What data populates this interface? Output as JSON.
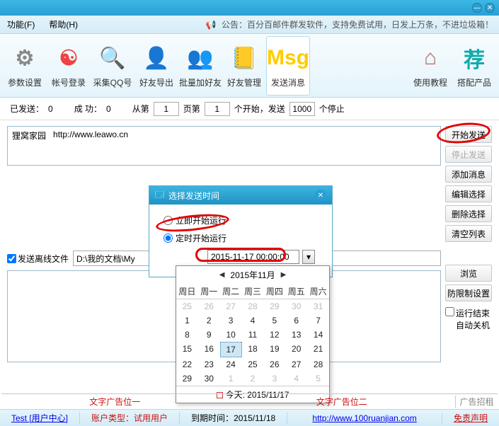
{
  "titlebar": {
    "minimize": "—",
    "close": "✕"
  },
  "menubar": {
    "items": [
      "功能(F)",
      "帮助(H)"
    ],
    "announcement_prefix": "公告：",
    "announcement": "百分百邮件群发软件，支持免费试用，日发上万条，不进垃圾箱！"
  },
  "toolbar": {
    "items": [
      {
        "label": "参数设置",
        "icon": "gear-icon",
        "color": "#888"
      },
      {
        "label": "帐号登录",
        "icon": "yinyang-icon",
        "color": "#e44"
      },
      {
        "label": "采集QQ号",
        "icon": "magnifier-icon",
        "color": "#f90"
      },
      {
        "label": "好友导出",
        "icon": "user-export-icon",
        "color": "#39c"
      },
      {
        "label": "批量加好友",
        "icon": "user-add-icon",
        "color": "#3b6"
      },
      {
        "label": "好友管理",
        "icon": "notebook-icon",
        "color": "#4a9"
      },
      {
        "label": "发送消息",
        "icon": "msg-icon",
        "color": "#fc0"
      },
      {
        "label": "使用教程",
        "icon": "home-icon",
        "color": "#b66"
      },
      {
        "label": "搭配产品",
        "icon": "recommend-icon",
        "color": "#1aa"
      }
    ],
    "active_index": 6
  },
  "stats": {
    "sent_label": "已发送：",
    "sent_value": "0",
    "success_label": "成  功：",
    "success_value": "0",
    "from_page_label": "从第",
    "page_value": "1",
    "page_unit": "页第",
    "item_value": "1",
    "item_suffix": "个开始，发送",
    "limit_value": "1000",
    "limit_suffix": "个停止"
  },
  "list": {
    "col1": "狸窝家园",
    "col2": "http://www.leawo.cn"
  },
  "side_buttons": [
    "开始发送",
    "停止发送",
    "添加消息",
    "编辑选择",
    "删除选择",
    "清空列表",
    "浏览",
    "防限制设置"
  ],
  "checkboxes": {
    "offline_file": "发送离线文件",
    "shutdown": "运行结束\n自动关机"
  },
  "offline_path": "D:\\我的文档\\My",
  "dialog": {
    "title": "选择发送时间",
    "opt_immediate": "立即开始运行",
    "opt_scheduled": "定时开始运行",
    "datetime": "2015-11-17 00:00:00"
  },
  "calendar": {
    "month_label": "2015年11月",
    "dow": [
      "周日",
      "周一",
      "周二",
      "周三",
      "周四",
      "周五",
      "周六"
    ],
    "leading_out": [
      25,
      26,
      27,
      28,
      29,
      30,
      31
    ],
    "days_in_month": 30,
    "today": 17,
    "trailing_out": [
      1,
      2,
      3,
      4,
      5
    ],
    "footer": "今天: 2015/11/17"
  },
  "adbar": {
    "left": "文字广告位一",
    "right": "文字广告位二",
    "recruit": "广告招租"
  },
  "status": {
    "user": "Test [用户中心]",
    "acct_type_label": "账户类型：",
    "acct_type_value": "试用用户",
    "expire_label": "到期时间：",
    "expire_value": "2015/11/18",
    "site": "http://www.100ruanjian.com",
    "disclaimer": "免责声明"
  }
}
